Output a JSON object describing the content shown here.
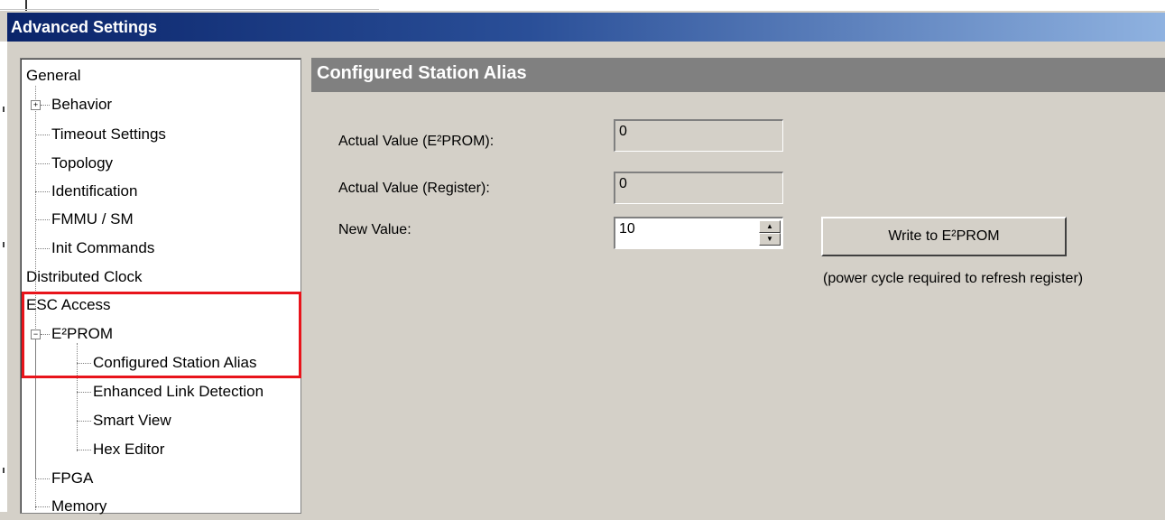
{
  "window": {
    "title": "Advanced Settings"
  },
  "tree": {
    "items": [
      {
        "label": "General"
      },
      {
        "label": "Behavior"
      },
      {
        "label": "Timeout Settings"
      },
      {
        "label": "Topology"
      },
      {
        "label": "Identification"
      },
      {
        "label": "FMMU / SM"
      },
      {
        "label": "Init Commands"
      },
      {
        "label": "Distributed Clock"
      },
      {
        "label": "ESC Access"
      },
      {
        "label": "E²PROM"
      },
      {
        "label": "Configured Station Alias"
      },
      {
        "label": "Enhanced Link Detection"
      },
      {
        "label": "Smart View"
      },
      {
        "label": "Hex Editor"
      },
      {
        "label": "FPGA"
      },
      {
        "label": "Memory"
      }
    ],
    "expanders": {
      "behavior": "+",
      "eeprom": "−"
    }
  },
  "panel": {
    "title": "Configured Station Alias",
    "fields": {
      "actual_eeprom_label": "Actual Value (E²PROM):",
      "actual_eeprom_value": "0",
      "actual_register_label": "Actual Value (Register):",
      "actual_register_value": "0",
      "new_value_label": "New Value:",
      "new_value_value": "10"
    },
    "write_button": "Write to E²PROM",
    "note": "(power cycle required to refresh register)"
  },
  "colors": {
    "highlight": "#e8141b",
    "header": "#808080",
    "titlebar": "#0a246a"
  }
}
